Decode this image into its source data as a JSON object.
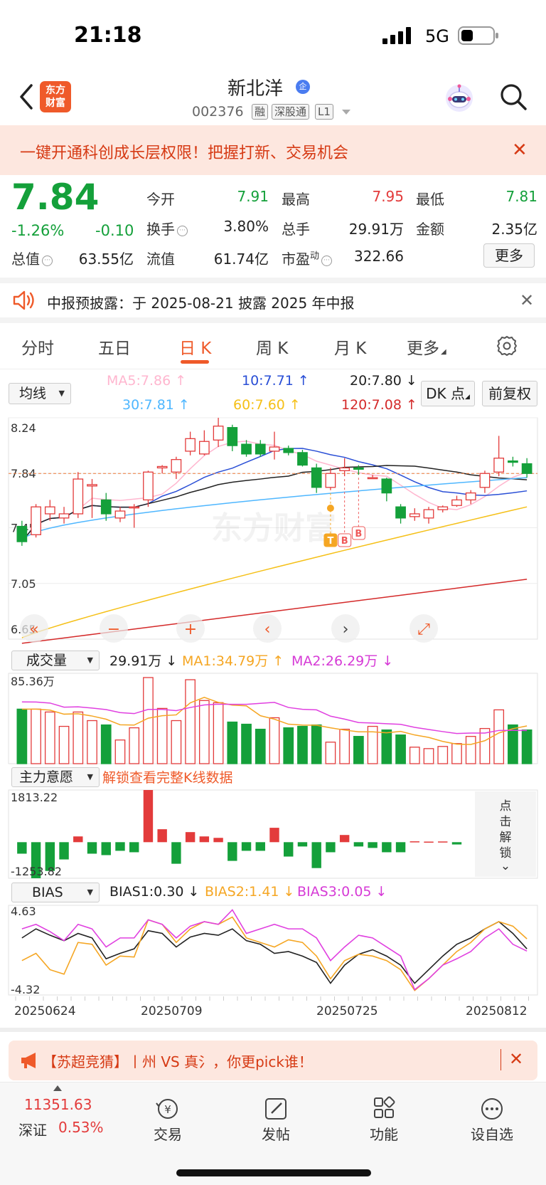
{
  "status": {
    "time": "21:18",
    "network": "5G"
  },
  "header": {
    "logo_line1": "东方",
    "logo_line2": "财富",
    "stock_name": "新北洋",
    "badge": "企",
    "stock_code": "002376",
    "tags": [
      "融",
      "深股通",
      "L1"
    ]
  },
  "promo": {
    "text": "一键开通科创成长层权限！把握打新、交易机会",
    "close": "✕"
  },
  "quote": {
    "price": "7.84",
    "change_pct": "-1.26%",
    "change": "-0.10",
    "fields": [
      {
        "label": "今开",
        "value": "7.91",
        "color": "#14a03a"
      },
      {
        "label": "最高",
        "value": "7.95",
        "color": "#e33b3b"
      },
      {
        "label": "最低",
        "value": "7.81",
        "color": "#14a03a"
      },
      {
        "label": "换手",
        "value": "3.80%",
        "color": "#222222"
      },
      {
        "label": "总手",
        "value": "29.91万",
        "color": "#222222"
      },
      {
        "label": "金额",
        "value": "2.35亿",
        "color": "#222222"
      },
      {
        "label": "总值",
        "value": "63.55亿",
        "color": "#222222"
      },
      {
        "label": "流值",
        "value": "61.74亿",
        "color": "#222222"
      },
      {
        "label": "市盈",
        "value": "322.66",
        "color": "#222222"
      }
    ],
    "pe_sup": "动",
    "more": "更多"
  },
  "notice": {
    "text": "中报预披露：于 2025-08-21 披露 2025 年中报",
    "close": "✕"
  },
  "tabs": [
    "分时",
    "五日",
    "日 K",
    "周 K",
    "月 K",
    "更多"
  ],
  "indicators": {
    "ma_select": "均线",
    "ma5": "MA5:7.86 ↑",
    "ma10": "10:7.71 ↑",
    "ma20": "20:7.80 ↓",
    "ma30": "30:7.81 ↑",
    "ma60": "60:7.60 ↑",
    "ma120": "120:7.08 ↑",
    "dk_btn": "DK 点",
    "fq_btn": "前复权",
    "vol_select": "成交量",
    "vol_value": "29.91万 ↓",
    "vol_ma1": "MA1:34.79万 ↑",
    "vol_ma2": "MA2:26.29万 ↓",
    "main_select": "主力意愿",
    "main_unlock": "解锁查看完整K线数据",
    "unlock_side": "点击解锁",
    "bias_select": "BIAS",
    "bias1": "BIAS1:0.30 ↓",
    "bias2": "BIAS2:1.41 ↓",
    "bias3": "BIAS3:0.05 ↓"
  },
  "chart_data": [
    {
      "type": "candlestick",
      "ylim": [
        6.65,
        8.24
      ],
      "y_ticks": [
        "8.24",
        "7.84",
        "7.45",
        "7.05",
        "6.65"
      ],
      "watermark": "东方财富",
      "markers": [
        "T",
        "B",
        "B"
      ],
      "candles": [
        [
          7.46,
          7.35,
          7.5,
          7.32
        ],
        [
          7.4,
          7.6,
          7.62,
          7.38
        ],
        [
          7.55,
          7.6,
          7.65,
          7.5
        ],
        [
          7.52,
          7.55,
          7.6,
          7.48
        ],
        [
          7.55,
          7.8,
          7.85,
          7.52
        ],
        [
          7.75,
          7.76,
          7.8,
          7.52
        ],
        [
          7.65,
          7.55,
          7.7,
          7.5
        ],
        [
          7.52,
          7.57,
          7.6,
          7.49
        ],
        [
          7.6,
          7.6,
          7.62,
          7.45
        ],
        [
          7.65,
          7.85,
          7.86,
          7.6
        ],
        [
          7.88,
          7.89,
          7.9,
          7.84
        ],
        [
          7.85,
          7.94,
          7.96,
          7.8
        ],
        [
          8.0,
          8.09,
          8.14,
          7.97
        ],
        [
          7.98,
          8.07,
          8.15,
          7.97
        ],
        [
          8.08,
          8.18,
          8.24,
          8.03
        ],
        [
          8.17,
          8.04,
          8.19,
          8.0
        ],
        [
          8.05,
          7.98,
          8.08,
          7.96
        ],
        [
          8.05,
          7.98,
          8.08,
          7.96
        ],
        [
          8.0,
          8.03,
          8.14,
          7.94
        ],
        [
          8.02,
          7.99,
          8.04,
          7.97
        ],
        [
          7.99,
          7.9,
          8.01,
          7.89
        ],
        [
          7.88,
          7.74,
          7.91,
          7.7
        ],
        [
          7.74,
          7.84,
          7.88,
          7.72
        ],
        [
          7.86,
          7.88,
          7.95,
          7.82
        ],
        [
          7.88,
          7.87,
          7.9,
          7.83
        ],
        [
          7.81,
          7.81,
          7.83,
          7.8
        ],
        [
          7.8,
          7.7,
          7.81,
          7.64
        ],
        [
          7.6,
          7.52,
          7.62,
          7.48
        ],
        [
          7.53,
          7.55,
          7.59,
          7.5
        ],
        [
          7.52,
          7.58,
          7.6,
          7.48
        ],
        [
          7.58,
          7.6,
          7.61,
          7.56
        ],
        [
          7.61,
          7.65,
          7.68,
          7.6
        ],
        [
          7.65,
          7.7,
          7.72,
          7.62
        ],
        [
          7.74,
          7.84,
          7.86,
          7.7
        ],
        [
          7.85,
          7.95,
          8.11,
          7.82
        ],
        [
          7.93,
          7.92,
          7.96,
          7.89
        ],
        [
          7.91,
          7.84,
          7.95,
          7.81
        ]
      ]
    },
    {
      "type": "bar",
      "title": "成交量",
      "y_max_label": "85.36万",
      "values": [
        76,
        76,
        72,
        52,
        72,
        60,
        54,
        33,
        50,
        120,
        77,
        60,
        117,
        88,
        85,
        58,
        55,
        48,
        64,
        50,
        52,
        54,
        30,
        48,
        38,
        52,
        47,
        40,
        23,
        21,
        24,
        28,
        38,
        49,
        75,
        54,
        47
      ]
    },
    {
      "type": "bar",
      "title": "主力意愿",
      "y_top_label": "1813.22",
      "y_bottom_label": "-1253.82",
      "values": [
        -400,
        -1253,
        -1000,
        -600,
        200,
        -400,
        -450,
        -300,
        -350,
        1813,
        450,
        -750,
        350,
        200,
        150,
        -650,
        -300,
        -300,
        500,
        -500,
        -150,
        -900,
        -350,
        250,
        -150,
        -200,
        -350,
        -350,
        30,
        20,
        25,
        -80
      ]
    },
    {
      "type": "line",
      "title": "BIAS",
      "ylim": [
        -4.32,
        4.63
      ],
      "x_labels": [
        "20250624",
        "20250709",
        "20250725",
        "20250812"
      ],
      "series": [
        {
          "name": "BIAS1",
          "color": "#222222",
          "values": [
            1.5,
            2.5,
            1.8,
            1.2,
            2.0,
            1.5,
            -0.8,
            -0.2,
            0.3,
            2.3,
            2.0,
            0.5,
            1.6,
            2.0,
            1.8,
            2.5,
            1.2,
            0.8,
            -0.2,
            0.0,
            -0.5,
            -1.2,
            -3.5,
            -1.5,
            -0.3,
            0.2,
            -0.5,
            -1.5,
            -3.5,
            -2.0,
            -0.5,
            0.8,
            1.5,
            2.5,
            3.3,
            2.0,
            0.3
          ]
        },
        {
          "name": "BIAS2",
          "color": "#f5a623",
          "values": [
            -1.0,
            -0.2,
            -2.0,
            -2.5,
            1.0,
            0.8,
            -1.5,
            -0.5,
            -0.6,
            3.5,
            3.0,
            1.0,
            2.5,
            3.3,
            3.0,
            3.8,
            1.5,
            1.0,
            0.5,
            1.3,
            1.0,
            -0.5,
            -3.0,
            -1.0,
            -0.3,
            -0.5,
            -1.0,
            -2.0,
            -4.3,
            -3.0,
            -1.5,
            0.0,
            1.0,
            2.5,
            3.3,
            2.8,
            1.4
          ]
        },
        {
          "name": "BIAS3",
          "color": "#e040e0",
          "values": [
            2.5,
            3.0,
            2.2,
            1.2,
            3.0,
            2.5,
            0.5,
            1.5,
            1.5,
            3.5,
            3.0,
            1.5,
            2.8,
            3.3,
            3.0,
            4.6,
            2.0,
            2.5,
            3.0,
            2.5,
            2.5,
            1.5,
            -1.0,
            0.5,
            1.8,
            1.5,
            0.5,
            -0.5,
            -4.2,
            -3.0,
            -1.5,
            -0.8,
            0.0,
            1.5,
            2.5,
            0.8,
            0.05
          ]
        }
      ]
    }
  ],
  "chart_controls": [
    "«",
    "−",
    "+",
    "‹",
    "›",
    "⤢"
  ],
  "ad": {
    "text": "【苏超竞猜】丨州 VS 真⺡，你更pick谁！",
    "close": "✕"
  },
  "bottom_nav": {
    "index_value": "11351.63",
    "index_name": "深证",
    "index_pct": "0.53%",
    "items": [
      "交易",
      "发帖",
      "功能",
      "设自选"
    ]
  }
}
